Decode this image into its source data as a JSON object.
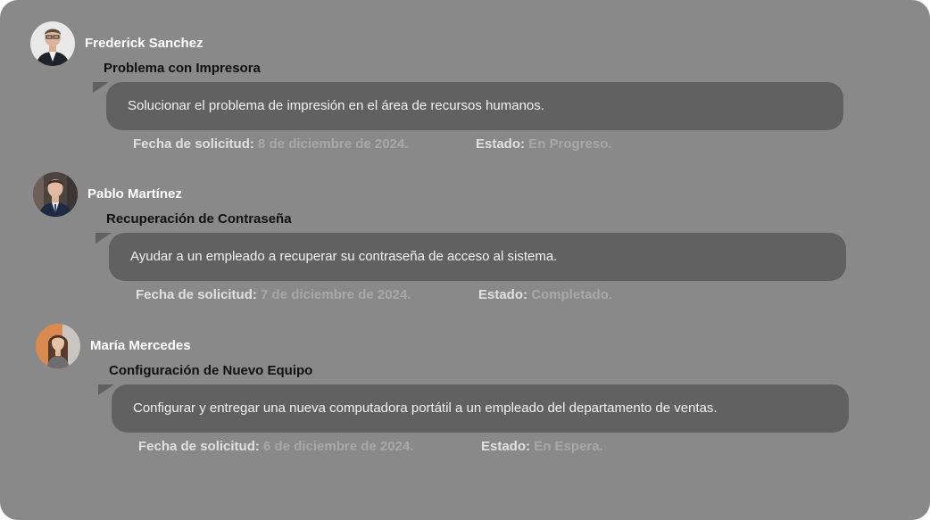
{
  "tickets": [
    {
      "user": "Frederick Sanchez",
      "title": "Problema con Impresora",
      "description": "Solucionar el problema de impresión en el área de recursos humanos.",
      "date_label": "Fecha de solicitud:",
      "date": "8 de diciembre de 2024.",
      "status_label": "Estado:",
      "status": "En Progreso."
    },
    {
      "user": "Pablo Martínez",
      "title": "Recuperación de Contraseña",
      "description": "Ayudar a un empleado a recuperar su contraseña de acceso al sistema.",
      "date_label": "Fecha de solicitud:",
      "date": "7 de diciembre de 2024.",
      "status_label": "Estado:",
      "status": "Completado."
    },
    {
      "user": "María Mercedes",
      "title": "Configuración de Nuevo Equipo",
      "description": "Configurar y entregar una nueva computadora portátil a un empleado del departamento de ventas.",
      "date_label": "Fecha de solicitud:",
      "date": "6 de diciembre de 2024.",
      "status_label": "Estado:",
      "status": "En Espera."
    }
  ],
  "colors": {
    "panel": "#898989",
    "bubble": "#616161",
    "name": "#ffffff",
    "title": "#111111",
    "meta_key": "#e0e0e0",
    "meta_value": "#a8a8a8"
  }
}
